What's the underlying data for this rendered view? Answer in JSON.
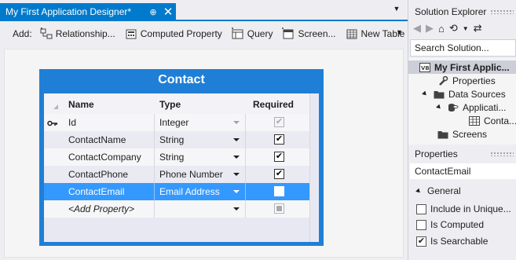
{
  "document": {
    "tab_title": "My First Application Designer*",
    "pin_glyph": "⊕",
    "close_glyph": "✕"
  },
  "toolbar": {
    "add_label": "Add:",
    "buttons": [
      {
        "label": "Relationship...",
        "icon": "relationship-icon"
      },
      {
        "label": "Computed Property",
        "icon": "computed-property-icon"
      },
      {
        "label": "Query",
        "icon": "query-icon"
      },
      {
        "label": "Screen...",
        "icon": "screen-icon"
      },
      {
        "label": "New Table",
        "icon": "new-table-icon"
      }
    ]
  },
  "entity": {
    "title": "Contact",
    "headers": {
      "name": "Name",
      "type": "Type",
      "required": "Required"
    },
    "rows": [
      {
        "name": "Id",
        "type": "Integer",
        "required": "checked-disabled",
        "key": true
      },
      {
        "name": "ContactName",
        "type": "String",
        "required": "checked"
      },
      {
        "name": "ContactCompany",
        "type": "String",
        "required": "checked"
      },
      {
        "name": "ContactPhone",
        "type": "Phone Number",
        "required": "checked"
      },
      {
        "name": "ContactEmail",
        "type": "Email Address",
        "required": "unchecked",
        "selected": true
      },
      {
        "name": "<Add Property>",
        "type": "",
        "required": "indeterminate",
        "placeholder": true
      }
    ]
  },
  "solution_explorer": {
    "title": "Solution Explorer",
    "search_placeholder": "Search Solution...",
    "tree": [
      {
        "label": "My First Applic...",
        "icon": "vb-project-icon",
        "bold": true,
        "selected": true
      },
      {
        "label": "Properties",
        "icon": "wrench-icon"
      },
      {
        "label": "Data Sources",
        "icon": "folder-icon",
        "expanded": true
      },
      {
        "label": "Applicati...",
        "icon": "database-icon",
        "expanded": true
      },
      {
        "label": "Conta...",
        "icon": "table-icon"
      },
      {
        "label": "Screens",
        "icon": "folder-icon"
      }
    ]
  },
  "properties": {
    "title": "Properties",
    "object_name": "ContactEmail",
    "category": "General",
    "items": [
      {
        "label": "Include in Unique...",
        "checked": false
      },
      {
        "label": "Is Computed",
        "checked": false
      },
      {
        "label": "Is Searchable",
        "checked": true
      }
    ]
  },
  "colors": {
    "accent": "#007acc",
    "entity_header": "#1f7fd6",
    "selected_row": "#3399ff"
  }
}
